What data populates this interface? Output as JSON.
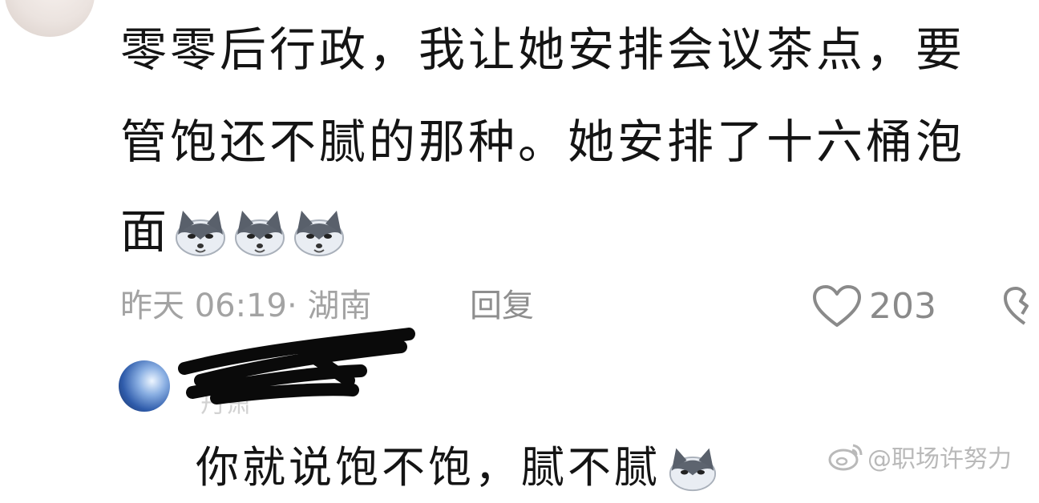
{
  "comment": {
    "lines": [
      "零零后行政，我让她安排会议茶点，要",
      "管饱还不腻的那种。她安排了十六桶泡",
      "面"
    ],
    "emoji": [
      "husky-icon",
      "husky-icon",
      "husky-icon"
    ],
    "timestamp": "昨天 06:19",
    "location": "· 湖南",
    "reply_label": "回复",
    "like_count": "203"
  },
  "reply": {
    "username_partial": "丹萧",
    "text": "你就说饱不饱，腻不腻",
    "emoji": "husky-icon"
  },
  "watermark": {
    "text": "@职场许努力",
    "icon": "weibo-icon"
  },
  "colors": {
    "text": "#141414",
    "meta": "#a3a3a3",
    "icon": "#8a8a8a"
  }
}
